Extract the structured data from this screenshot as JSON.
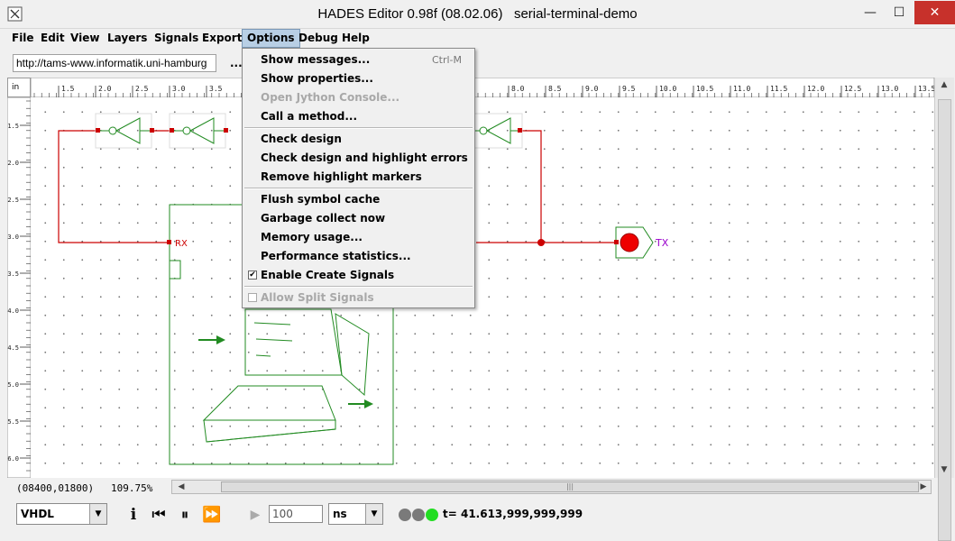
{
  "window": {
    "title": "HADES Editor 0.98f (08.02.06)   serial-terminal-demo",
    "controls": {
      "minimize": "—",
      "maximize": "☐",
      "close": "✕"
    }
  },
  "menubar": [
    "File",
    "Edit",
    "View",
    "Layers",
    "Signals",
    "Export",
    "Options",
    "Debug",
    "Help"
  ],
  "toolbar": {
    "url": "http://tams-www.informatik.uni-hamburg",
    "dots": "..."
  },
  "ruler": {
    "unit": "in",
    "top_ticks": [
      "1.5",
      "2.0",
      "2.5",
      "3.0",
      "3.5",
      "8.0",
      "8.5",
      "9.0",
      "9.5",
      "10.0",
      "10.5",
      "11.0",
      "11.5",
      "12.0",
      "12.5",
      "13.0",
      "13.5"
    ],
    "left_ticks": [
      "1.5",
      "2.0",
      "2.5",
      "3.0",
      "3.5",
      "4.0",
      "4.5",
      "5.0",
      "5.5",
      "6.0"
    ]
  },
  "schematic": {
    "rx_label": "RX",
    "tx_label": "TX"
  },
  "options_menu": {
    "items": [
      {
        "label": "Show messages...",
        "shortcut": "Ctrl-M",
        "enabled": true
      },
      {
        "label": "Show properties...",
        "enabled": true
      },
      {
        "label": "Open Jython Console...",
        "enabled": false
      },
      {
        "label": "Call a method...",
        "enabled": true
      },
      {
        "label": "Check design",
        "enabled": true
      },
      {
        "label": "Check design and highlight errors",
        "enabled": true
      },
      {
        "label": "Remove highlight markers",
        "enabled": true
      },
      {
        "label": "Flush symbol cache",
        "enabled": true
      },
      {
        "label": "Garbage collect now",
        "enabled": true
      },
      {
        "label": "Memory usage...",
        "enabled": true
      },
      {
        "label": "Performance statistics...",
        "enabled": true
      },
      {
        "label": "Enable Create Signals",
        "checked": true,
        "enabled": true
      },
      {
        "label": "Allow Split Signals",
        "checked": false,
        "enabled": false
      }
    ]
  },
  "status": {
    "coords": "(08400,01800)",
    "zoom": "109.75%"
  },
  "controls": {
    "language": "VHDL",
    "step_value": "100",
    "unit": "ns",
    "time": "t= 41.613,999,999,999",
    "leds": [
      "#7a7a7a",
      "#7a7a7a",
      "#22dd22"
    ]
  },
  "colors": {
    "wire": "#cc0000",
    "component": "#228b22",
    "menu_highlight": "#b8cfe5"
  }
}
